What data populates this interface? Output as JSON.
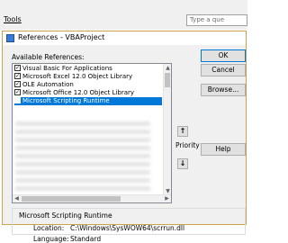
{
  "menu": {
    "tools_label": "Tools"
  },
  "question_box": {
    "placeholder": "Type a que"
  },
  "dialog": {
    "title": "References - VBAProject",
    "available_label": "Available References:",
    "references": [
      {
        "label": "Visual Basic For Applications",
        "checked": true,
        "selected": false
      },
      {
        "label": "Microsoft Excel 12.0 Object Library",
        "checked": true,
        "selected": false
      },
      {
        "label": "OLE Automation",
        "checked": true,
        "selected": false
      },
      {
        "label": "Microsoft Office 12.0 Object Library",
        "checked": true,
        "selected": false
      },
      {
        "label": "Microsoft Scripting Runtime",
        "checked": true,
        "selected": true
      }
    ],
    "buttons": {
      "ok": "OK",
      "cancel": "Cancel",
      "browse": "Browse...",
      "help": "Help"
    },
    "priority_label": "Priority",
    "priority_up": "↑",
    "priority_down": "↓",
    "details": {
      "group_title": "Microsoft Scripting Runtime",
      "location_label": "Location:",
      "location_value": "C:\\Windows\\SysWOW64\\scrrun.dll",
      "language_label": "Language:",
      "language_value": "Standard"
    }
  }
}
